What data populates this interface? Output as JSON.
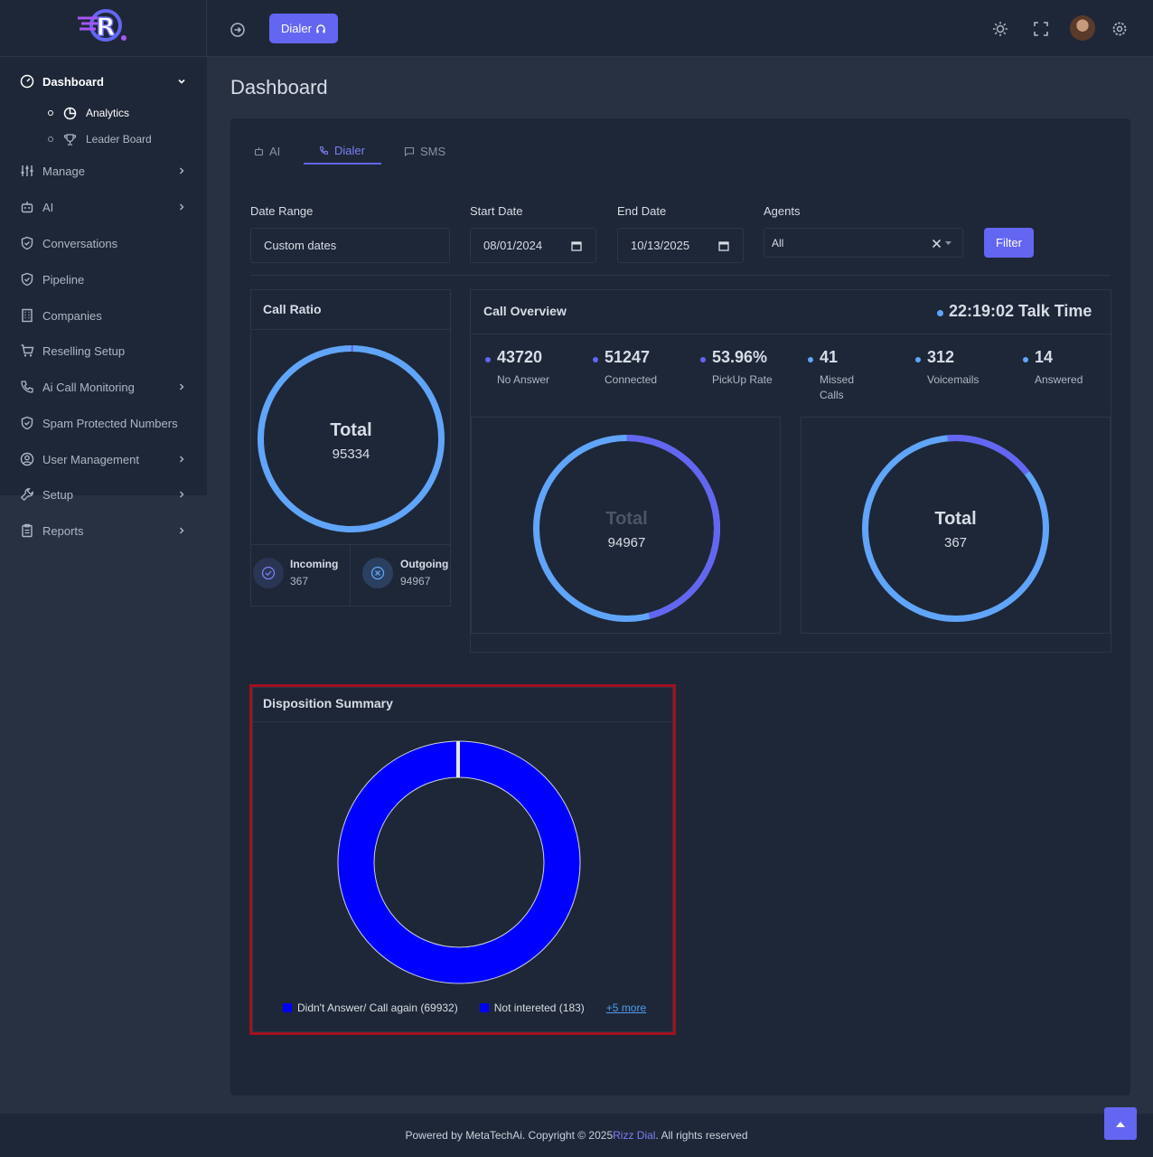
{
  "header": {
    "dialer_label": "Dialer"
  },
  "sidebar": {
    "items": [
      {
        "label": "Dashboard",
        "icon": "dashboard-icon"
      },
      {
        "label": "Manage",
        "icon": "sliders-icon"
      },
      {
        "label": "AI",
        "icon": "robot-icon"
      },
      {
        "label": "Conversations",
        "icon": "shield-icon"
      },
      {
        "label": "Pipeline",
        "icon": "shield-icon"
      },
      {
        "label": "Companies",
        "icon": "building-icon"
      },
      {
        "label": "Reselling Setup",
        "icon": "cart-icon"
      },
      {
        "label": "Ai Call Monitoring",
        "icon": "phone-icon"
      },
      {
        "label": "Spam Protected Numbers",
        "icon": "shield-icon"
      },
      {
        "label": "User Management",
        "icon": "user-circle-icon"
      },
      {
        "label": "Setup",
        "icon": "wrench-icon"
      },
      {
        "label": "Reports",
        "icon": "clipboard-icon"
      }
    ],
    "subitems": [
      {
        "label": "Analytics",
        "icon": "pie-chart-icon"
      },
      {
        "label": "Leader Board",
        "icon": "trophy-icon"
      }
    ]
  },
  "page": {
    "title": "Dashboard"
  },
  "tabs": [
    {
      "label": "AI"
    },
    {
      "label": "Dialer"
    },
    {
      "label": "SMS"
    }
  ],
  "filters": {
    "date_range_label": "Date Range",
    "date_range_value": "Custom dates",
    "start_label": "Start Date",
    "start_value": "08/01/2024",
    "end_label": "End Date",
    "end_value": "10/13/2025",
    "agents_label": "Agents",
    "agents_value": "All",
    "filter_button": "Filter"
  },
  "call_ratio": {
    "title": "Call Ratio",
    "total_label": "Total",
    "total_value": "95334",
    "incoming_label": "Incoming",
    "incoming_value": "367",
    "outgoing_label": "Outgoing",
    "outgoing_value": "94967"
  },
  "call_overview": {
    "title": "Call Overview",
    "talk_time": "22:19:02 Talk Time",
    "stats": [
      {
        "value": "43720",
        "label": "No Answer",
        "color": "#6366f1"
      },
      {
        "value": "51247",
        "label": "Connected",
        "color": "#6366f1"
      },
      {
        "value": "53.96%",
        "label": "PickUp Rate",
        "color": "#6366f1"
      },
      {
        "value": "41",
        "label": "Missed Calls",
        "color": "#4f9bf0"
      },
      {
        "value": "312",
        "label": "Voicemails",
        "color": "#4f9bf0"
      },
      {
        "value": "14",
        "label": "Answered",
        "color": "#4f9bf0"
      }
    ],
    "donut_left_label": "Total",
    "donut_left_value": "94967",
    "donut_right_label": "Total",
    "donut_right_value": "367"
  },
  "disposition": {
    "title": "Disposition Summary",
    "legend_1": "Didn't Answer/ Call again (69932)",
    "legend_2": "Not intereted (183)",
    "more": "+5 more"
  },
  "footer": {
    "text_before": "Powered by MetaTechAi. Copyright © 2025 ",
    "brand": "Rizz Dial",
    "text_after": ". All rights reserved"
  },
  "colors": {
    "accent": "#6366f1",
    "ring_blue": "#60a5fa",
    "disposition_blue": "#0000ff"
  }
}
